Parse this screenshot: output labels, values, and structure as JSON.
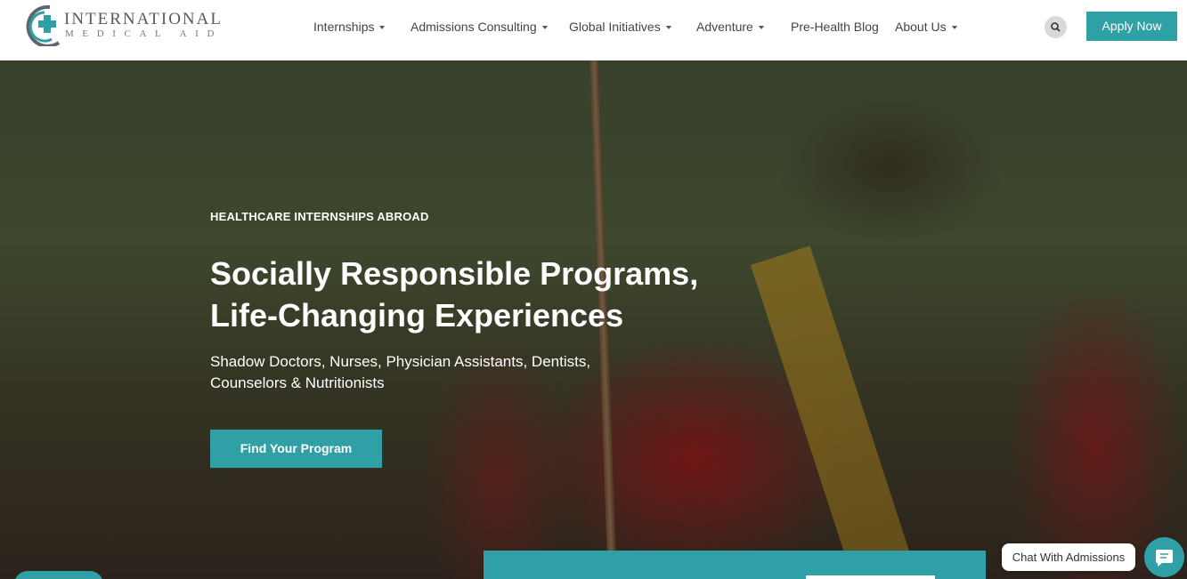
{
  "logo": {
    "line1": "INTERNATIONAL",
    "line2": "MEDICAL AID",
    "icon": "medical-cross-icon"
  },
  "nav": {
    "items": [
      {
        "label": "Internships",
        "dropdown": true
      },
      {
        "label": "Admissions Consulting",
        "dropdown": true
      },
      {
        "label": "Global Initiatives",
        "dropdown": true
      },
      {
        "label": "Adventure",
        "dropdown": true
      },
      {
        "label": "Pre-Health Blog",
        "dropdown": false
      },
      {
        "label": "About Us",
        "dropdown": true
      }
    ],
    "search_icon": "search-icon",
    "apply_label": "Apply Now"
  },
  "hero": {
    "eyebrow": "HEALTHCARE INTERNSHIPS ABROAD",
    "headline_line1": "Socially Responsible Programs,",
    "headline_line2": "Life-Changing Experiences",
    "subhead_line1": "Shadow Doctors, Nurses, Physician Assistants, Dentists,",
    "subhead_line2": "Counselors & Nutritionists",
    "cta_label": "Find Your Program"
  },
  "chat": {
    "label": "Chat With Admissions",
    "icon": "chat-icon"
  },
  "colors": {
    "accent": "#2ea0a6",
    "header_bg": "#ffffff",
    "nav_text": "#444444"
  }
}
